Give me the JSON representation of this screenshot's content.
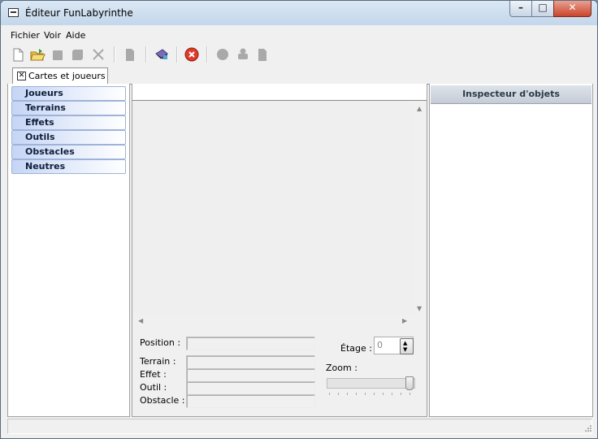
{
  "window": {
    "title": "Éditeur FunLabyrinthe"
  },
  "menu": [
    {
      "label": "Fichier"
    },
    {
      "label": "Voir"
    },
    {
      "label": "Aide"
    }
  ],
  "toolbar": {
    "buttons": [
      {
        "icon": "new-file-icon"
      },
      {
        "icon": "open-folder-icon"
      },
      {
        "icon": "save-icon"
      },
      {
        "icon": "save-all-icon"
      },
      {
        "icon": "close-file-icon"
      },
      {
        "icon": "document-icon"
      },
      {
        "icon": "compile-icon"
      },
      {
        "icon": "stop-icon"
      },
      {
        "icon": "circle-icon"
      },
      {
        "icon": "puzzle-icon"
      },
      {
        "icon": "page-icon"
      }
    ]
  },
  "tabs": [
    {
      "label": "Cartes et joueurs"
    }
  ],
  "categories": [
    {
      "label": "Joueurs"
    },
    {
      "label": "Terrains"
    },
    {
      "label": "Effets"
    },
    {
      "label": "Outils"
    },
    {
      "label": "Obstacles"
    },
    {
      "label": "Neutres"
    }
  ],
  "info": {
    "position_label": "Position :",
    "terrain_label": "Terrain :",
    "effet_label": "Effet :",
    "outil_label": "Outil :",
    "obstacle_label": "Obstacle :",
    "position_value": "",
    "terrain_value": "",
    "effet_value": "",
    "outil_value": "",
    "obstacle_value": ""
  },
  "floor": {
    "label": "Étage :",
    "value": "0"
  },
  "zoom": {
    "label": "Zoom :",
    "level": 1.0
  },
  "inspector": {
    "title": "Inspecteur d'objets"
  },
  "colors": {
    "category_gradient_start": "#c5d5f5",
    "category_text": "#0f1e3c",
    "stop_button": "#e03a2a"
  }
}
